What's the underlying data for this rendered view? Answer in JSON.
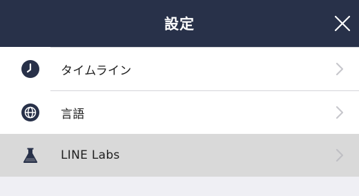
{
  "header": {
    "title": "設定",
    "close_icon": "close-icon",
    "background_color": "#283149"
  },
  "settings_list": {
    "items": [
      {
        "label": "タイムライン",
        "icon": "clock-icon",
        "chevron": "chevron-right-icon"
      },
      {
        "label": "言語",
        "icon": "globe-icon",
        "chevron": "chevron-right-icon"
      },
      {
        "label": "LINE Labs",
        "icon": "flask-icon",
        "chevron": "chevron-right-icon",
        "state": "pressed"
      }
    ]
  },
  "colors": {
    "icon_color": "#283149",
    "row_pressed": "#d9d9d9",
    "chevron": "#c7c7cc"
  }
}
